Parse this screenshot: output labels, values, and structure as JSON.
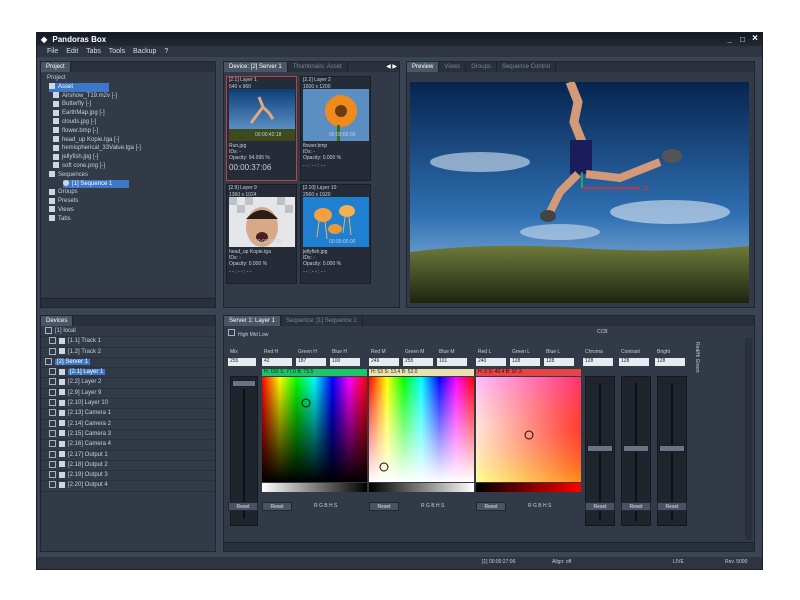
{
  "app": {
    "title": "Pandoras Box"
  },
  "menu": [
    "File",
    "Edit",
    "Tabs",
    "Tools",
    "Backup",
    "?"
  ],
  "window_controls": {
    "min": "_",
    "max": "□",
    "close": "×"
  },
  "project": {
    "tab": "Project",
    "root": "Project",
    "items": [
      {
        "label": "Asset",
        "selected": true
      },
      {
        "label": "Airshow_T19.m2v [-]"
      },
      {
        "label": "Butterfly [-]"
      },
      {
        "label": "EarthMap.jpg [-]"
      },
      {
        "label": "clouds.jpg [-]"
      },
      {
        "label": "flower.bmp [-]"
      },
      {
        "label": "head_up Kopie.tga [-]"
      },
      {
        "label": "hemispherical_33Value.tga [-]"
      },
      {
        "label": "jellyfish.jpg [-]"
      },
      {
        "label": "soft cone.png [-]"
      },
      {
        "label": "Sequences"
      },
      {
        "label": "[1] Sequence 1",
        "selected": true
      },
      {
        "label": "Groups"
      },
      {
        "label": "Presets"
      },
      {
        "label": "Views"
      },
      {
        "label": "Tabs"
      }
    ]
  },
  "devices_panel": {
    "tab": "Devices",
    "items": [
      {
        "label": "[1] local"
      },
      {
        "label": "[1.1] Track 1"
      },
      {
        "label": "[1.2] Track 2"
      },
      {
        "label": "[2] Server 1",
        "selected": true
      },
      {
        "label": "[2.1] Layer 1",
        "selected": true
      },
      {
        "label": "[2.2] Layer 2"
      },
      {
        "label": "[2.9] Layer 9"
      },
      {
        "label": "[2.10] Layer 10"
      },
      {
        "label": "[2.13] Camera 1"
      },
      {
        "label": "[2.14] Camera 2"
      },
      {
        "label": "[2.15] Camera 3"
      },
      {
        "label": "[2.16] Camera 4"
      },
      {
        "label": "[2.17] Output 1"
      },
      {
        "label": "[2.18] Output 2"
      },
      {
        "label": "[2.19] Output 3"
      },
      {
        "label": "[2.20] Output 4"
      }
    ]
  },
  "device_tabs": [
    "Device: [2] Server 1",
    "Thumbnails: Asset"
  ],
  "thumbnails": [
    {
      "header": "[2.1] Layer 1",
      "size": "640 x 960",
      "time": "00:00:42:18",
      "name": "Run.jpg",
      "id": "IDs: -",
      "opacity": "Opacity: 94.995 %",
      "clock": "00:00:37:06",
      "active": true
    },
    {
      "header": "[2.2] Layer 2",
      "size": "1600 x 1200",
      "time": "00:00:00:00",
      "name": "flower.bmp",
      "id": "IDs: -",
      "opacity": "Opacity: 0.000 %",
      "clock": "- - : - - : - -"
    },
    {
      "header": "[2.9] Layer 9",
      "size": "1360 x 1024",
      "time": "00:00:00:00",
      "name": "head_up Kopie.tga",
      "id": "IDs: -",
      "opacity": "Opacity: 0.000 %",
      "clock": "- - : - - : - -"
    },
    {
      "header": "[2.10] Layer 10",
      "size": "2560 x 1920",
      "time": "00:00:00:00",
      "name": "jellyfish.jpg",
      "id": "IDs: -",
      "opacity": "Opacity: 0.000 %",
      "clock": "- - : - - : - -"
    }
  ],
  "preview_tabs": [
    "Preview",
    "Views",
    "Groups",
    "Sequence Control"
  ],
  "bottom_tabs": [
    "Server 1: Layer 1",
    "Sequence: [1] Sequence 1"
  ],
  "color": {
    "mode_label": "High Mid Low",
    "ccb_label": "CCB",
    "side_label": "Red/Hi Green",
    "col_labels": [
      "Mix",
      "Red H",
      "Green H",
      "Blue H",
      "Red M",
      "Green M",
      "Blue M",
      "Red L",
      "Green L",
      "Blue L",
      "Chroma",
      "Contrast",
      "Bright"
    ],
    "values": [
      "255",
      "42",
      "187",
      "100",
      "249",
      "255",
      "101",
      "240",
      "128",
      "128",
      "128",
      "128",
      "128"
    ],
    "picker_labels": [
      "H: 156 S: 77.0 B: 73.5",
      "H: 53 S: 13.4 B: 52.0",
      "H: 0 S: 40.4 B: 97.3"
    ],
    "reset_label": "Reset",
    "channels": "R G B H S",
    "accent_hi": "#1ec46a",
    "accent_mid": "#e8e3b0",
    "accent_low": "#e64545"
  },
  "status_bar": {
    "timecode": "[1] 00:00:27:06",
    "align": "Align: off",
    "mode": "LIVE",
    "rev": "Rev. 5090"
  }
}
